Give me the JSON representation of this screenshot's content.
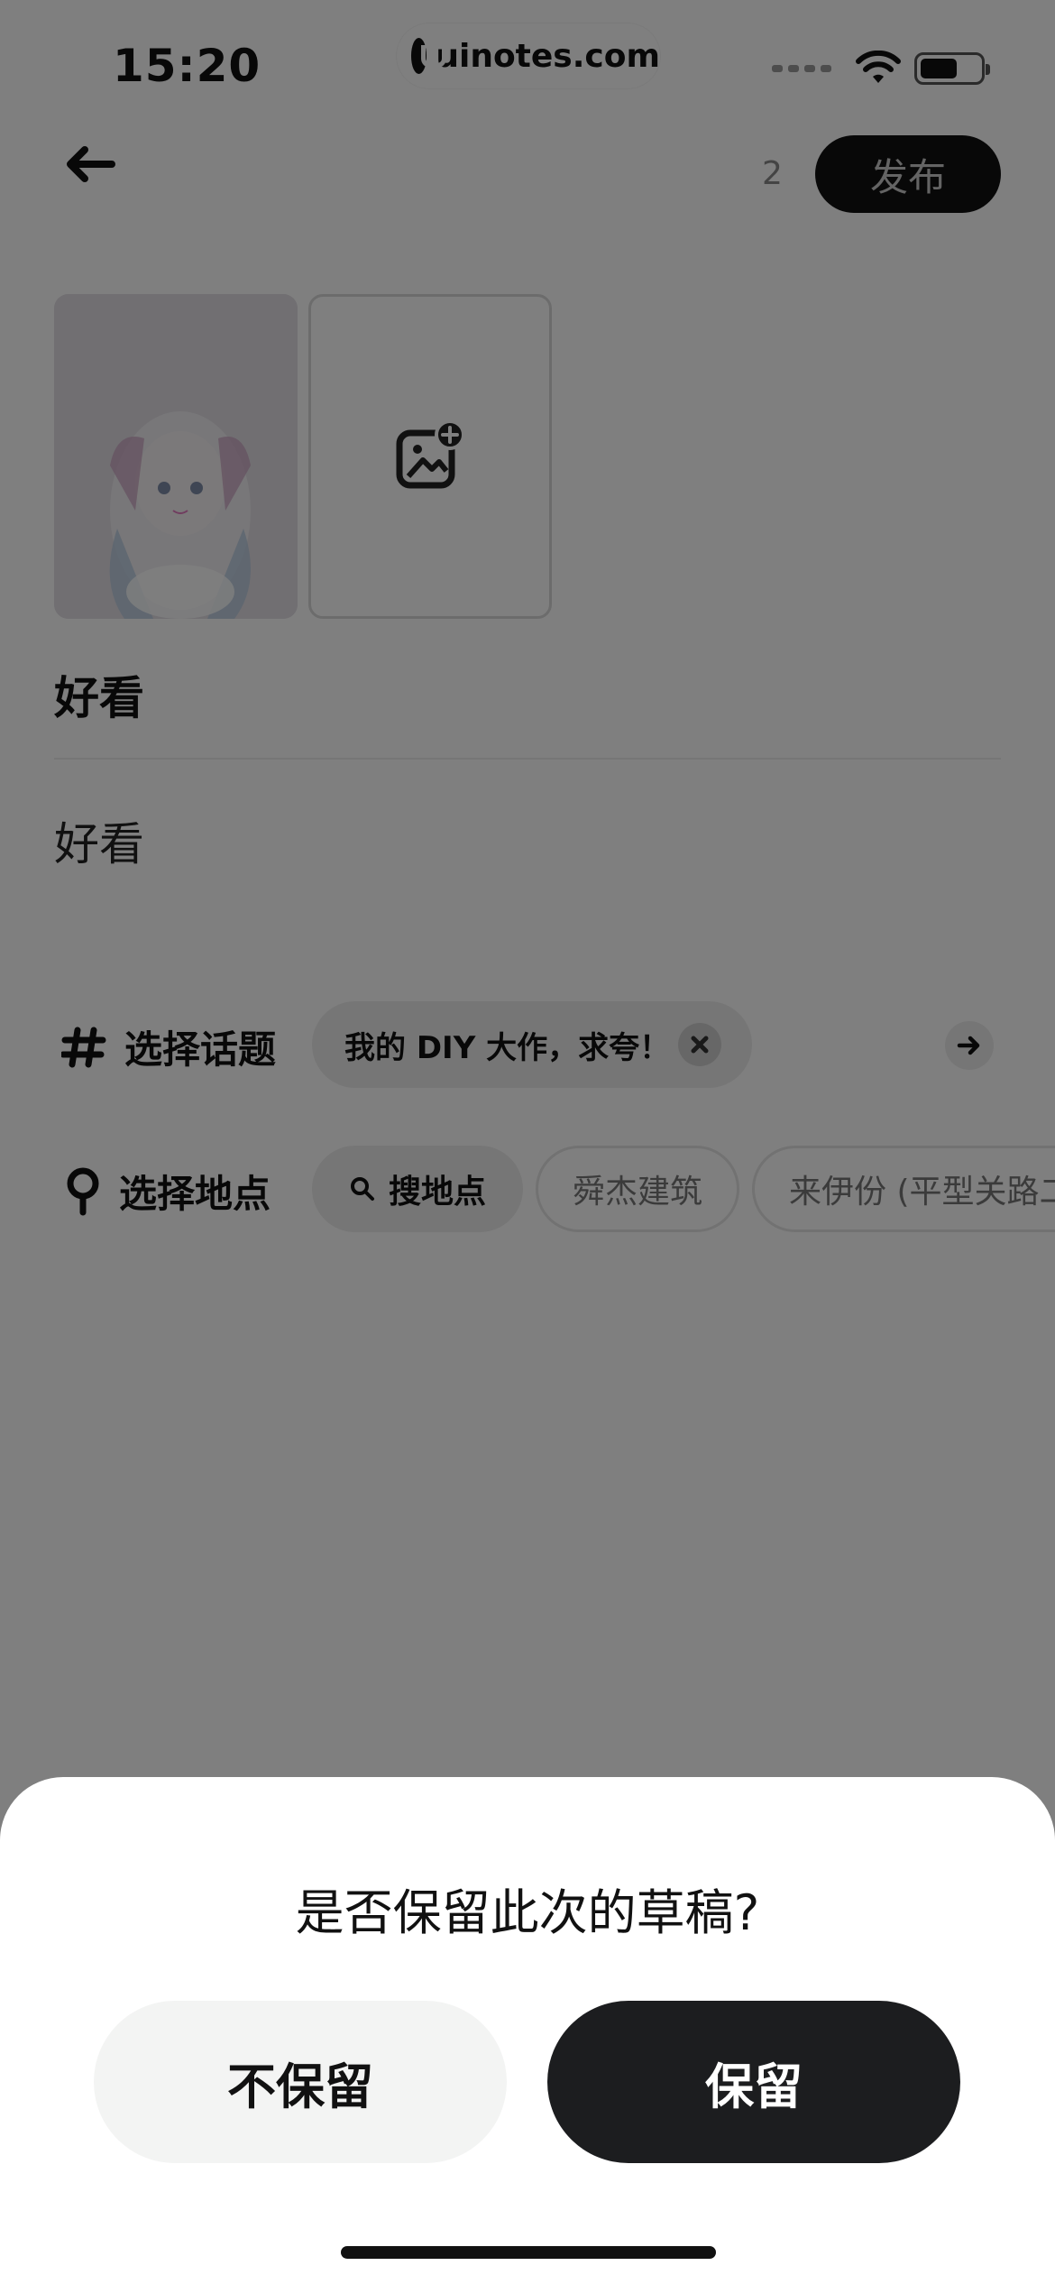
{
  "status_bar": {
    "time": "15:20",
    "watermark": "uinotes.com"
  },
  "header": {
    "counter": "2",
    "publish_label": "发布"
  },
  "post": {
    "title": "好看",
    "body": "好看"
  },
  "topic": {
    "label": "选择话题",
    "chip": "我的 DIY 大作，求夸！"
  },
  "location": {
    "label": "选择地点",
    "search_chip": "搜地点",
    "suggestions": [
      "舜杰建筑",
      "来伊份 (平型关路二"
    ]
  },
  "dialog": {
    "title": "是否保留此次的草稿?",
    "discard_label": "不保留",
    "keep_label": "保留"
  },
  "colors": {
    "overlay": "#000000",
    "primary_button": "#1c1d1f",
    "secondary_button": "#f3f4f3"
  }
}
